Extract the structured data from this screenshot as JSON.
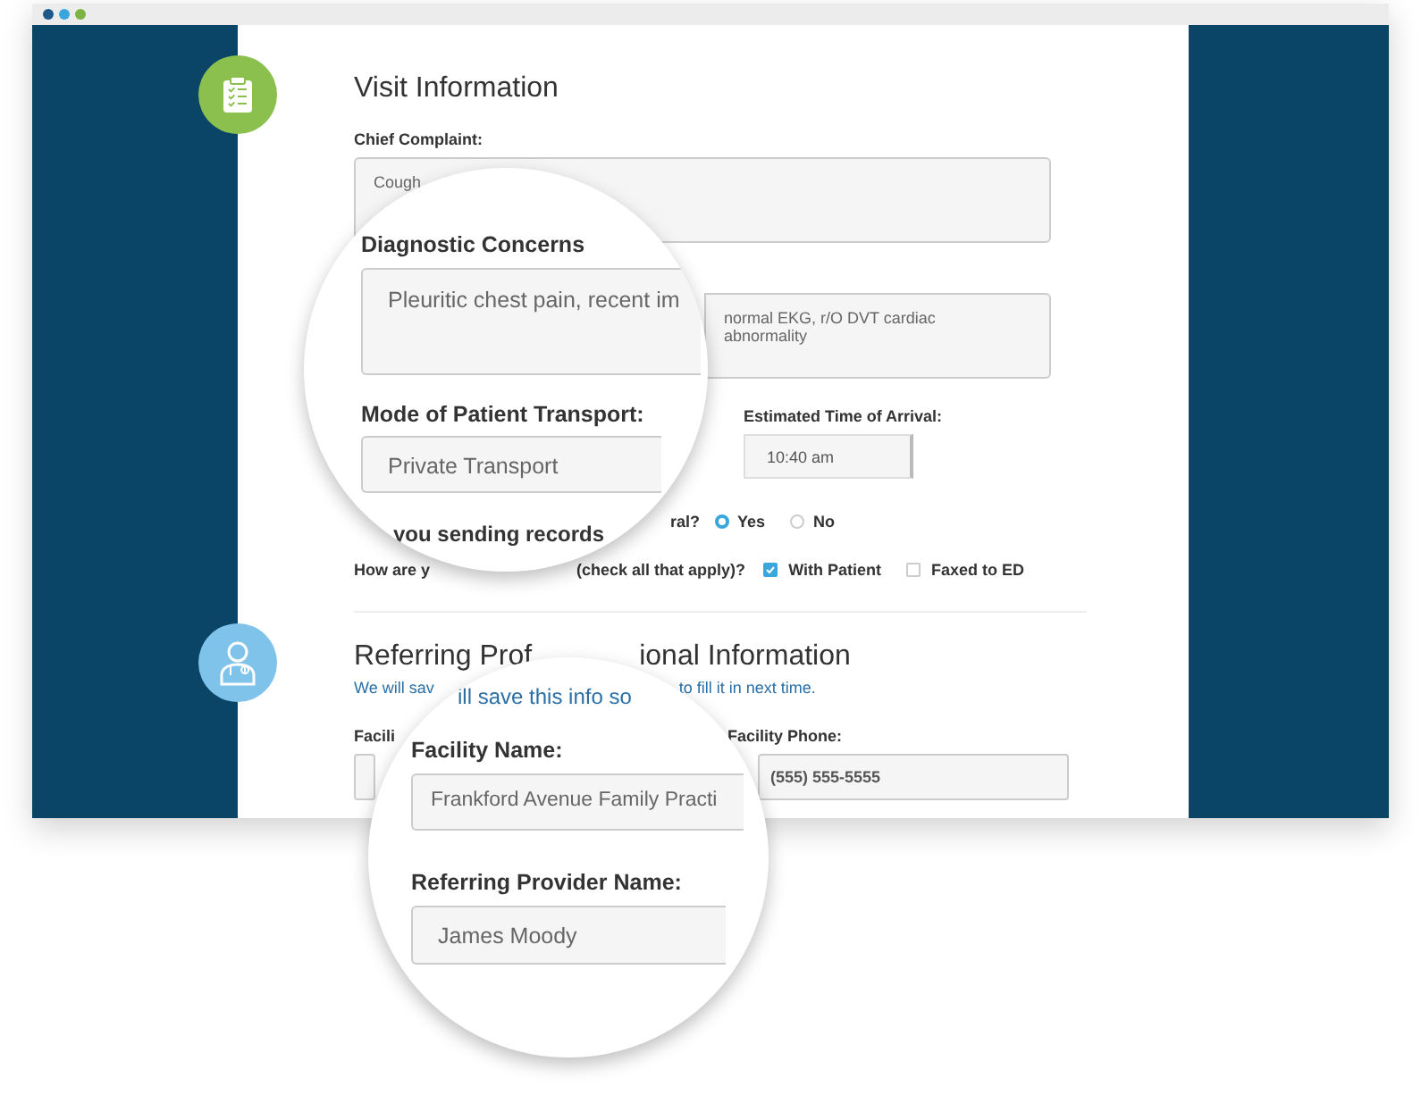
{
  "visit_information": {
    "title": "Visit Information",
    "chief_complaint": {
      "label": "Chief Complaint:",
      "value": "Cough"
    },
    "diagnostic_concerns": {
      "value": "normal EKG,  r/O DVT cardiac abnormality"
    },
    "arrival_time": {
      "label": "Estimated Time of Arrival:",
      "value": "10:40 am"
    },
    "records_question": {
      "text": "ral?",
      "options": [
        {
          "label": "Yes",
          "selected": true
        },
        {
          "label": "No",
          "selected": false
        }
      ]
    },
    "records_method": {
      "text_start": "How are y",
      "text_end": "(check all that apply)?",
      "options": [
        {
          "label": "With Patient",
          "checked": true
        },
        {
          "label": "Faxed to ED",
          "checked": false
        }
      ]
    }
  },
  "referring_professional": {
    "title_start": "Referring Prof",
    "title_end": "ional Information",
    "note_start": "We will sav",
    "note_end": "to fill it in next time.",
    "facility_label": "Facili",
    "phone": {
      "label": "Facility Phone:",
      "value": "(555) 555-5555"
    }
  },
  "magnifier_top": {
    "diagnostic_label": "Diagnostic Concerns",
    "diagnostic_value": "Pleuritic chest pain,  recent im",
    "transport_label": "Mode of Patient Transport:",
    "transport_value": "Private Transport",
    "records_fragment": "you sending records"
  },
  "magnifier_bottom": {
    "note_fragment": "ill save this info so",
    "facility_label": "Facility Name:",
    "facility_value": "Frankford Avenue Family Practi",
    "provider_label": "Referring Provider Name:",
    "provider_value": "James Moody"
  }
}
